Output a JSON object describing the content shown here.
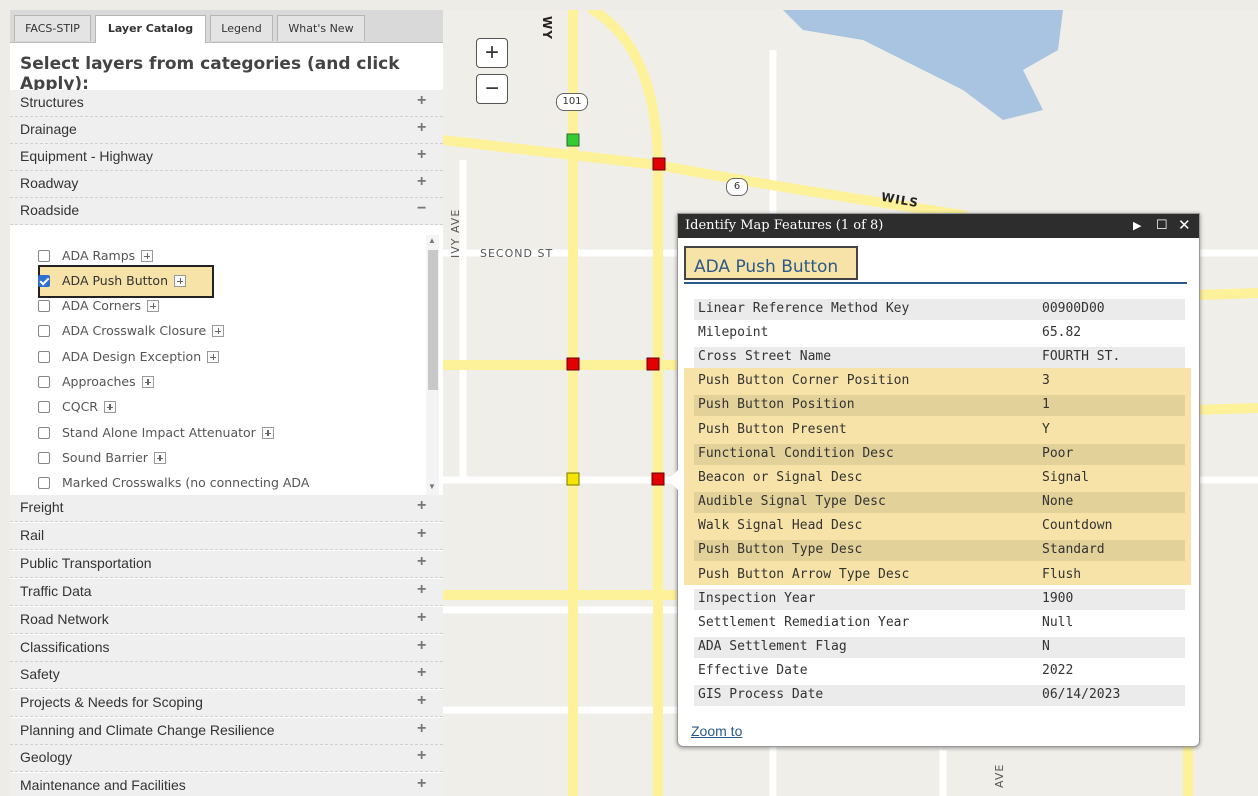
{
  "tabs": [
    {
      "label": "FACS-STIP"
    },
    {
      "label": "Layer Catalog"
    },
    {
      "label": "Legend"
    },
    {
      "label": "What's New"
    }
  ],
  "panel_title": "Select layers from categories (and click Apply):",
  "categories_top": [
    {
      "label": "Structures",
      "toggle": "+"
    },
    {
      "label": "Drainage",
      "toggle": "+"
    },
    {
      "label": "Equipment - Highway",
      "toggle": "+"
    },
    {
      "label": "Roadway",
      "toggle": "+"
    },
    {
      "label": "Roadside",
      "toggle": "−"
    }
  ],
  "roadside_layers": [
    {
      "label": "ADA Ramps",
      "checked": false
    },
    {
      "label": "ADA Push Button",
      "checked": true
    },
    {
      "label": "ADA Corners",
      "checked": false
    },
    {
      "label": "ADA Crosswalk Closure",
      "checked": false
    },
    {
      "label": "ADA Design Exception",
      "checked": false
    },
    {
      "label": "Approaches",
      "checked": false
    },
    {
      "label": "CQCR",
      "checked": false
    },
    {
      "label": "Stand Alone Impact Attenuator",
      "checked": false
    },
    {
      "label": "Sound Barrier",
      "checked": false
    },
    {
      "label": "Marked Crosswalks (no connecting ADA",
      "checked": false
    }
  ],
  "categories_bottom": [
    {
      "label": "Freight",
      "toggle": "+"
    },
    {
      "label": "Rail",
      "toggle": "+"
    },
    {
      "label": "Public Transportation",
      "toggle": "+"
    },
    {
      "label": "Traffic Data",
      "toggle": "+"
    },
    {
      "label": "Road Network",
      "toggle": "+"
    },
    {
      "label": "Classifications",
      "toggle": "+"
    },
    {
      "label": "Safety",
      "toggle": "+"
    },
    {
      "label": "Projects & Needs for Scoping",
      "toggle": "+"
    },
    {
      "label": "Planning and Climate Change Resilience",
      "toggle": "+"
    },
    {
      "label": "Geology",
      "toggle": "+"
    },
    {
      "label": "Maintenance and Facilities",
      "toggle": "+"
    }
  ],
  "map": {
    "zoom_in": "+",
    "zoom_out": "−",
    "labels": {
      "second_st": "SECOND ST",
      "ivy_ave": "IVY AVE",
      "wilson": "WILS",
      "hwy": "WY",
      "ave_bottom": "AVE",
      "us101": "101",
      "route6": "6"
    },
    "colors": {
      "road": "#fdf19a",
      "water": "#a8c4e0",
      "marker_red": "#e30000",
      "marker_green": "#33cc33",
      "marker_yellow": "#f5e400"
    }
  },
  "popup": {
    "title": "Identify Map Features (1 of 8)",
    "icons": {
      "next": "play-icon",
      "maximize": "maximize-icon",
      "close": "close-icon"
    },
    "feature_title": "ADA Push Button",
    "attributes": [
      {
        "key": "Linear Reference Method Key",
        "value": "00900D00"
      },
      {
        "key": "Milepoint",
        "value": "65.82"
      },
      {
        "key": "Cross Street Name",
        "value": "FOURTH ST."
      },
      {
        "key": "Push Button Corner Position",
        "value": "3"
      },
      {
        "key": "Push Button Position",
        "value": "1"
      },
      {
        "key": "Push Button Present",
        "value": "Y"
      },
      {
        "key": "Functional Condition Desc",
        "value": "Poor"
      },
      {
        "key": "Beacon or Signal Desc",
        "value": "Signal"
      },
      {
        "key": "Audible Signal Type Desc",
        "value": "None"
      },
      {
        "key": "Walk Signal Head Desc",
        "value": "Countdown"
      },
      {
        "key": "Push Button Type Desc",
        "value": "Standard"
      },
      {
        "key": "Push Button Arrow Type Desc",
        "value": "Flush"
      },
      {
        "key": "Inspection Year",
        "value": "1900"
      },
      {
        "key": "Settlement Remediation Year",
        "value": "Null"
      },
      {
        "key": "ADA Settlement Flag",
        "value": "N"
      },
      {
        "key": "Effective Date",
        "value": "2022"
      },
      {
        "key": "GIS Process Date",
        "value": "06/14/2023"
      }
    ],
    "zoom_link": "Zoom to"
  }
}
